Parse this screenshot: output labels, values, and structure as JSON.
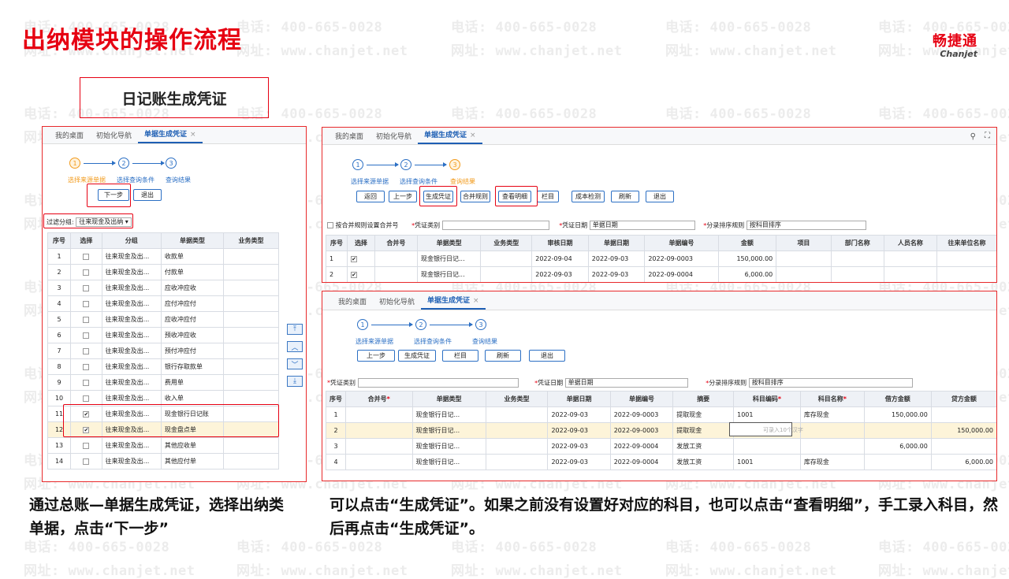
{
  "watermark": {
    "phone": "电话: 400-665-0028",
    "site": "网址: www.chanjet.net"
  },
  "slide": {
    "title": "出纳模块的操作流程",
    "subtitle": "日记账生成凭证"
  },
  "brand": {
    "cn": "畅捷通",
    "en": "Chanjet",
    "accent": "#e60012"
  },
  "tabs": {
    "desk": "我的桌面",
    "nav": "初始化导航",
    "active": "单据生成凭证",
    "close": "×"
  },
  "steps": {
    "s1": "选择来源单据",
    "s2": "选择查询条件",
    "s3": "查询结果",
    "n1": "1",
    "n2": "2",
    "n3": "3"
  },
  "left": {
    "next": "下一步",
    "exit": "退出",
    "filter_label": "过滤分组:",
    "filter_value": "往来现金及出纳",
    "headers": [
      "序号",
      "选择",
      "分组",
      "单据类型",
      "业务类型"
    ],
    "rows": [
      [
        "1",
        "",
        "往来现金及出...",
        "收款单"
      ],
      [
        "2",
        "",
        "往来现金及出...",
        "付款单"
      ],
      [
        "3",
        "",
        "往来现金及出...",
        "应收冲应收"
      ],
      [
        "4",
        "",
        "往来现金及出...",
        "应付冲应付"
      ],
      [
        "5",
        "",
        "往来现金及出...",
        "应收冲应付"
      ],
      [
        "6",
        "",
        "往来现金及出...",
        "预收冲应收"
      ],
      [
        "7",
        "",
        "往来现金及出...",
        "预付冲应付"
      ],
      [
        "8",
        "",
        "往来现金及出...",
        "银行存取款单"
      ],
      [
        "9",
        "",
        "往来现金及出...",
        "费用单"
      ],
      [
        "10",
        "",
        "往来现金及出...",
        "收入单"
      ],
      [
        "11",
        "✔",
        "往来现金及出...",
        "现金银行日记账"
      ],
      [
        "12",
        "✔",
        "往来现金及出...",
        "现金盘点单"
      ],
      [
        "13",
        "",
        "往来现金及出...",
        "其他应收单"
      ],
      [
        "14",
        "",
        "往来现金及出...",
        "其他应付单"
      ]
    ],
    "side_icons": [
      "double-up-icon",
      "up-icon",
      "down-icon",
      "double-down-icon"
    ],
    "side_glyphs": [
      "⤒",
      "︿",
      "﹀",
      "⤓"
    ]
  },
  "topright": {
    "buttons": [
      "返回",
      "上一步",
      "生成凭证",
      "合并规则",
      "查看明细",
      "栏目",
      "成本检测",
      "刷新",
      "退出"
    ],
    "merge_label": "按合并规则设置合并号",
    "vtype_label": "凭证类别",
    "vdate_label": "凭证日期",
    "vdate_value": "单据日期",
    "sort_label": "分录排序规则",
    "sort_value": "按科目排序",
    "headers": [
      "序号",
      "选择",
      "合并号",
      "单据类型",
      "业务类型",
      "审核日期",
      "单据日期",
      "单据编号",
      "金额",
      "项目",
      "部门名称",
      "人员名称",
      "往来单位名称"
    ],
    "rows": [
      [
        "1",
        "✔",
        "",
        "现金银行日记...",
        "",
        "2022-09-04",
        "2022-09-03",
        "2022-09-0003",
        "150,000.00"
      ],
      [
        "2",
        "✔",
        "",
        "现金银行日记...",
        "",
        "2022-09-03",
        "2022-09-03",
        "2022-09-0004",
        "6,000.00"
      ]
    ]
  },
  "bottomright": {
    "buttons": [
      "上一步",
      "生成凭证",
      "栏目",
      "刷新",
      "退出"
    ],
    "vtype_label": "凭证类别",
    "vdate_label": "凭证日期",
    "vdate_value": "单据日期",
    "sort_label": "分录排序规则",
    "sort_value": "按科目排序",
    "headers": [
      "序号",
      "合并号",
      "单据类型",
      "业务类型",
      "单据日期",
      "单据编号",
      "摘要",
      "科目编码",
      "科目名称",
      "借方金额",
      "贷方金额"
    ],
    "rows": [
      [
        "1",
        "",
        "现金银行日记...",
        "",
        "2022-09-03",
        "2022-09-0003",
        "提取现金",
        "1001",
        "库存现金",
        "150,000.00",
        ""
      ],
      [
        "2",
        "",
        "现金银行日记...",
        "",
        "2022-09-03",
        "2022-09-0003",
        "提取现金",
        "",
        "",
        "",
        "150,000.00"
      ],
      [
        "3",
        "",
        "现金银行日记...",
        "",
        "2022-09-03",
        "2022-09-0004",
        "发放工资",
        "",
        "",
        "6,000.00",
        ""
      ],
      [
        "4",
        "",
        "现金银行日记...",
        "",
        "2022-09-03",
        "2022-09-0004",
        "发放工资",
        "1001",
        "库存现金",
        "",
        "6,000.00"
      ]
    ],
    "input_hint": "可录入10个汉字"
  },
  "captions": {
    "left": "通过总账—单据生成凭证，选择出纳类单据，点击“下一步”",
    "right": "可以点击“生成凭证”。如果之前没有设置好对应的科目，也可以点击“查看明细”，手工录入科目，然后再点击“生成凭证”。"
  }
}
